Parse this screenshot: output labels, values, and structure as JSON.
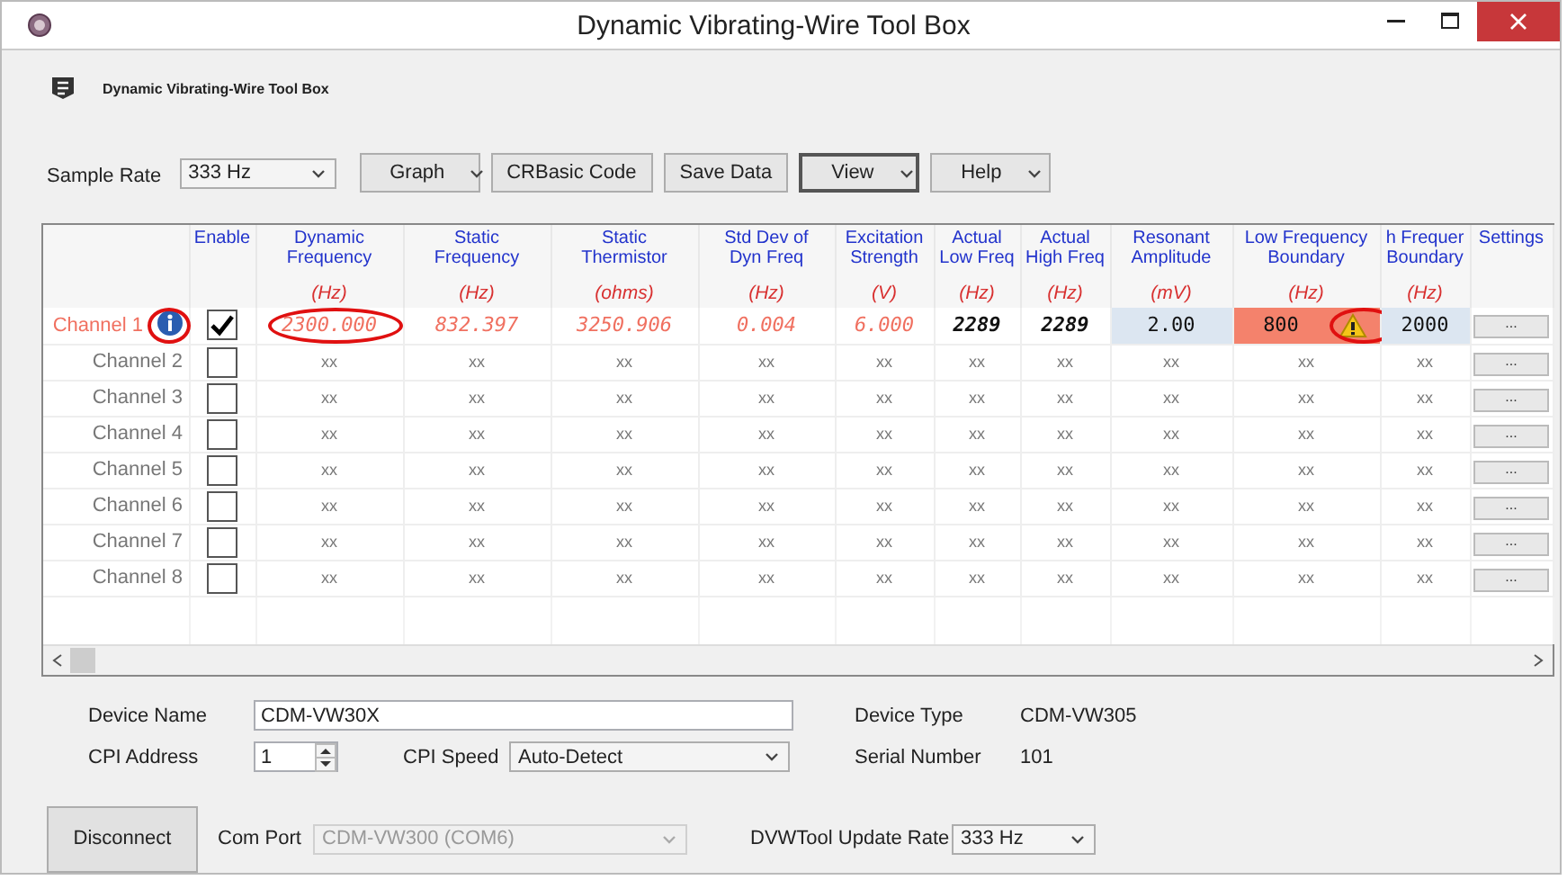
{
  "window": {
    "title": "Dynamic Vibrating-Wire Tool Box"
  },
  "app_header": {
    "title": "Dynamic Vibrating-Wire Tool Box"
  },
  "toolbar": {
    "sample_rate_label": "Sample Rate",
    "sample_rate": "333 Hz",
    "buttons": [
      {
        "label": "Graph",
        "kind": "menu",
        "focused": false
      },
      {
        "label": "CRBasic Code",
        "kind": "button",
        "focused": false
      },
      {
        "label": "Save Data",
        "kind": "button",
        "focused": false
      },
      {
        "label": "View",
        "kind": "menu",
        "focused": true
      },
      {
        "label": "Help",
        "kind": "menu",
        "focused": false
      }
    ]
  },
  "table": {
    "enable_heading": "Enable",
    "settings_heading": "Settings",
    "columns": [
      {
        "heading": "Dynamic\nFrequency",
        "unit": "(Hz)"
      },
      {
        "heading": "Static\nFrequency",
        "unit": "(Hz)"
      },
      {
        "heading": "Static\nThermistor",
        "unit": "(ohms)"
      },
      {
        "heading": "Std Dev of\nDyn Freq",
        "unit": "(Hz)"
      },
      {
        "heading": "Excitation\nStrength",
        "unit": "(V)"
      },
      {
        "heading": "Actual\nLow Freq",
        "unit": "(Hz)"
      },
      {
        "heading": "Actual\nHigh Freq",
        "unit": "(Hz)"
      },
      {
        "heading": "Resonant\nAmplitude",
        "unit": "(mV)"
      },
      {
        "heading": "Low Frequency\nBoundary",
        "unit": "(Hz)"
      },
      {
        "heading": "h Frequer\nBoundary",
        "unit": "(Hz)"
      }
    ],
    "rows": [
      {
        "name": "Channel 1",
        "active": true,
        "info": true,
        "info_circled": true,
        "enabled": true,
        "settings_button": "...",
        "cells": [
          {
            "text": "2300.000",
            "kind": "reading",
            "circled": true
          },
          {
            "text": "832.397",
            "kind": "reading"
          },
          {
            "text": "3250.906",
            "kind": "reading"
          },
          {
            "text": "0.004",
            "kind": "reading"
          },
          {
            "text": "6.000",
            "kind": "reading"
          },
          {
            "text": "2289",
            "kind": "actual"
          },
          {
            "text": "2289",
            "kind": "actual"
          },
          {
            "text": "2.00",
            "kind": "setting"
          },
          {
            "text": "800",
            "kind": "alert",
            "warning": true,
            "circled": true
          },
          {
            "text": "2000",
            "kind": "setting"
          }
        ]
      },
      {
        "name": "Channel 2",
        "active": false,
        "enabled": false,
        "settings_button": "...",
        "cells": [
          {
            "text": "xx",
            "kind": "empty"
          },
          {
            "text": "xx",
            "kind": "empty"
          },
          {
            "text": "xx",
            "kind": "empty"
          },
          {
            "text": "xx",
            "kind": "empty"
          },
          {
            "text": "xx",
            "kind": "empty"
          },
          {
            "text": "xx",
            "kind": "empty"
          },
          {
            "text": "xx",
            "kind": "empty"
          },
          {
            "text": "xx",
            "kind": "empty"
          },
          {
            "text": "xx",
            "kind": "empty"
          },
          {
            "text": "xx",
            "kind": "empty"
          }
        ]
      },
      {
        "name": "Channel 3",
        "active": false,
        "enabled": false,
        "settings_button": "...",
        "cells": [
          {
            "text": "xx",
            "kind": "empty"
          },
          {
            "text": "xx",
            "kind": "empty"
          },
          {
            "text": "xx",
            "kind": "empty"
          },
          {
            "text": "xx",
            "kind": "empty"
          },
          {
            "text": "xx",
            "kind": "empty"
          },
          {
            "text": "xx",
            "kind": "empty"
          },
          {
            "text": "xx",
            "kind": "empty"
          },
          {
            "text": "xx",
            "kind": "empty"
          },
          {
            "text": "xx",
            "kind": "empty"
          },
          {
            "text": "xx",
            "kind": "empty"
          }
        ]
      },
      {
        "name": "Channel 4",
        "active": false,
        "enabled": false,
        "settings_button": "...",
        "cells": [
          {
            "text": "xx",
            "kind": "empty"
          },
          {
            "text": "xx",
            "kind": "empty"
          },
          {
            "text": "xx",
            "kind": "empty"
          },
          {
            "text": "xx",
            "kind": "empty"
          },
          {
            "text": "xx",
            "kind": "empty"
          },
          {
            "text": "xx",
            "kind": "empty"
          },
          {
            "text": "xx",
            "kind": "empty"
          },
          {
            "text": "xx",
            "kind": "empty"
          },
          {
            "text": "xx",
            "kind": "empty"
          },
          {
            "text": "xx",
            "kind": "empty"
          }
        ]
      },
      {
        "name": "Channel 5",
        "active": false,
        "enabled": false,
        "settings_button": "...",
        "cells": [
          {
            "text": "xx",
            "kind": "empty"
          },
          {
            "text": "xx",
            "kind": "empty"
          },
          {
            "text": "xx",
            "kind": "empty"
          },
          {
            "text": "xx",
            "kind": "empty"
          },
          {
            "text": "xx",
            "kind": "empty"
          },
          {
            "text": "xx",
            "kind": "empty"
          },
          {
            "text": "xx",
            "kind": "empty"
          },
          {
            "text": "xx",
            "kind": "empty"
          },
          {
            "text": "xx",
            "kind": "empty"
          },
          {
            "text": "xx",
            "kind": "empty"
          }
        ]
      },
      {
        "name": "Channel 6",
        "active": false,
        "enabled": false,
        "settings_button": "...",
        "cells": [
          {
            "text": "xx",
            "kind": "empty"
          },
          {
            "text": "xx",
            "kind": "empty"
          },
          {
            "text": "xx",
            "kind": "empty"
          },
          {
            "text": "xx",
            "kind": "empty"
          },
          {
            "text": "xx",
            "kind": "empty"
          },
          {
            "text": "xx",
            "kind": "empty"
          },
          {
            "text": "xx",
            "kind": "empty"
          },
          {
            "text": "xx",
            "kind": "empty"
          },
          {
            "text": "xx",
            "kind": "empty"
          },
          {
            "text": "xx",
            "kind": "empty"
          }
        ]
      },
      {
        "name": "Channel 7",
        "active": false,
        "enabled": false,
        "settings_button": "...",
        "cells": [
          {
            "text": "xx",
            "kind": "empty"
          },
          {
            "text": "xx",
            "kind": "empty"
          },
          {
            "text": "xx",
            "kind": "empty"
          },
          {
            "text": "xx",
            "kind": "empty"
          },
          {
            "text": "xx",
            "kind": "empty"
          },
          {
            "text": "xx",
            "kind": "empty"
          },
          {
            "text": "xx",
            "kind": "empty"
          },
          {
            "text": "xx",
            "kind": "empty"
          },
          {
            "text": "xx",
            "kind": "empty"
          },
          {
            "text": "xx",
            "kind": "empty"
          }
        ]
      },
      {
        "name": "Channel 8",
        "active": false,
        "enabled": false,
        "settings_button": "...",
        "cells": [
          {
            "text": "xx",
            "kind": "empty"
          },
          {
            "text": "xx",
            "kind": "empty"
          },
          {
            "text": "xx",
            "kind": "empty"
          },
          {
            "text": "xx",
            "kind": "empty"
          },
          {
            "text": "xx",
            "kind": "empty"
          },
          {
            "text": "xx",
            "kind": "empty"
          },
          {
            "text": "xx",
            "kind": "empty"
          },
          {
            "text": "xx",
            "kind": "empty"
          },
          {
            "text": "xx",
            "kind": "empty"
          },
          {
            "text": "xx",
            "kind": "empty"
          }
        ]
      }
    ]
  },
  "device": {
    "device_name_label": "Device Name",
    "device_name": "CDM-VW30X",
    "device_type_label": "Device Type",
    "device_type": "CDM-VW305",
    "cpi_address_label": "CPI Address",
    "cpi_address": "1",
    "cpi_speed_label": "CPI Speed",
    "cpi_speed": "Auto-Detect",
    "serial_number_label": "Serial Number",
    "serial_number": "101",
    "disconnect_button": "Disconnect",
    "com_port_label": "Com Port",
    "com_port": "CDM-VW300 (COM6)",
    "com_port_disabled": true,
    "update_rate_label": "DVWTool Update Rate",
    "update_rate": "333 Hz"
  }
}
